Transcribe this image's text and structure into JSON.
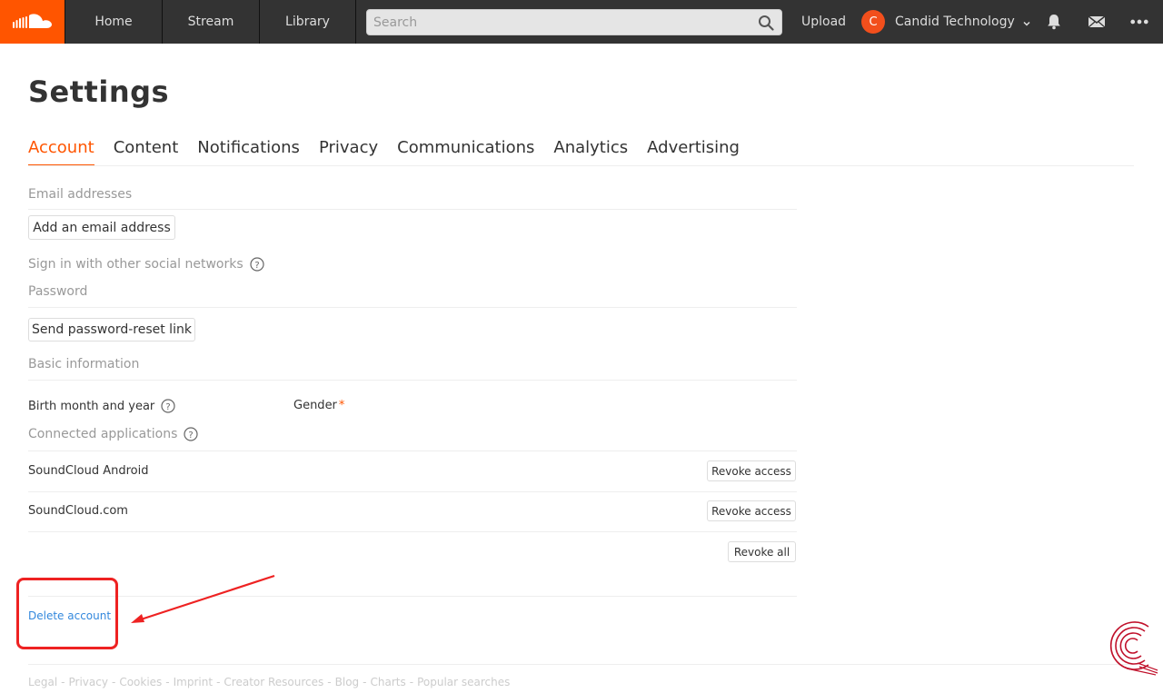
{
  "colors": {
    "brand": "#ff5500",
    "topbar": "#333333",
    "link": "#3388dd",
    "annotation": "#ee2222"
  },
  "topbar": {
    "logo_icon": "soundcloud-cloud-icon",
    "nav": {
      "home": "Home",
      "stream": "Stream",
      "library": "Library"
    },
    "search_placeholder": "Search",
    "search_icon": "search-icon",
    "upload": "Upload",
    "user": {
      "initial": "C",
      "name": "Candid Technology"
    },
    "icons": [
      "bell-icon",
      "mail-icon",
      "more-icon"
    ]
  },
  "page": {
    "title": "Settings"
  },
  "tabs": [
    "Account",
    "Content",
    "Notifications",
    "Privacy",
    "Communications",
    "Analytics",
    "Advertising"
  ],
  "account": {
    "email_section": "Email addresses",
    "add_email_button": "Add an email address",
    "social_section": "Sign in with other social networks",
    "password_section": "Password",
    "password_reset_button": "Send password-reset link",
    "basic_info_section": "Basic information",
    "birth_label": "Birth month and year",
    "gender_label": "Gender",
    "gender_required": "*",
    "connected_apps_section": "Connected applications",
    "apps": [
      {
        "name": "SoundCloud Android",
        "action": "Revoke access"
      },
      {
        "name": "SoundCloud.com",
        "action": "Revoke access"
      }
    ],
    "revoke_all": "Revoke all",
    "delete_account": "Delete account"
  },
  "footer": [
    "Legal",
    "Privacy",
    "Cookies",
    "Imprint",
    "Creator Resources",
    "Blog",
    "Charts",
    "Popular searches"
  ]
}
